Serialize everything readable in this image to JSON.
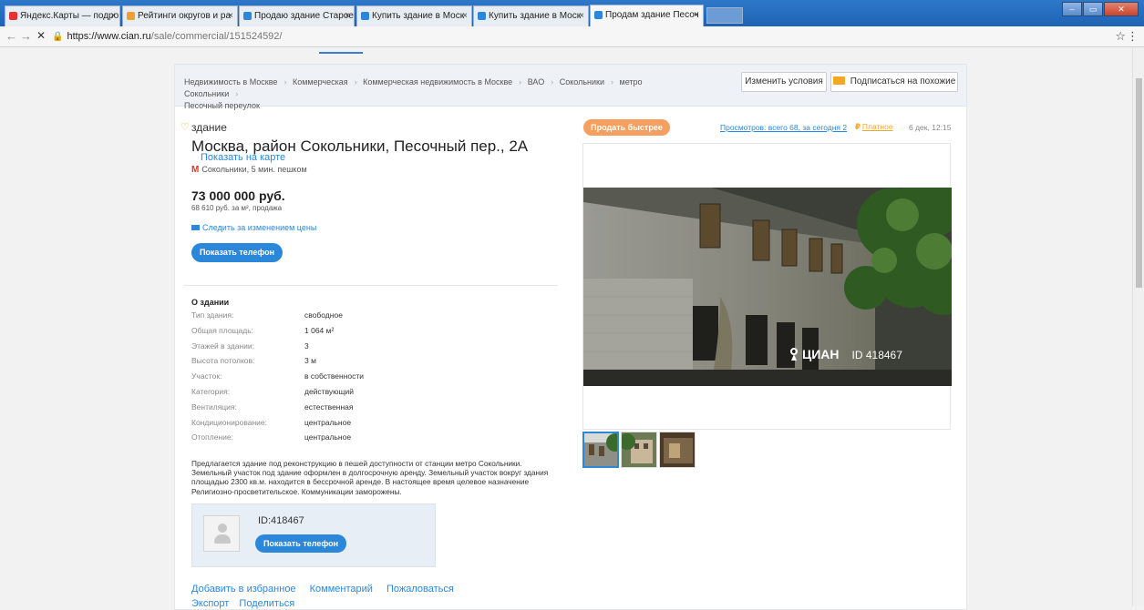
{
  "browser": {
    "tabs": [
      {
        "label": "Яндекс.Карты — подро",
        "icon": "yandex-maps-icon",
        "color": "#e3342f"
      },
      {
        "label": "Рейтинги округов и ра",
        "icon": "page-icon",
        "color": "#f0a030"
      },
      {
        "label": "Продаю здание Старое",
        "icon": "page-icon",
        "color": "#2b87da"
      },
      {
        "label": "Купить здание в Моск",
        "icon": "page-icon",
        "color": "#2b87da"
      },
      {
        "label": "Купить здание в Моск",
        "icon": "page-icon",
        "color": "#2b87da"
      },
      {
        "label": "Продам здание Песоч",
        "icon": "loading-icon",
        "color": "#2b87da"
      }
    ],
    "url_host": "https://www.cian.ru",
    "url_path": "/sale/commercial/151524592/",
    "back": "←",
    "forward": "→",
    "stop": "✕",
    "star": "☆",
    "menu": "⋮",
    "win_min": "–",
    "win_max": "▭",
    "win_close": "✕"
  },
  "breadcrumbs": [
    "Недвижимость в Москве",
    "Коммерческая",
    "Коммерческая недвижимость в Москве",
    "ВАО",
    "Сокольники",
    "метро Сокольники",
    "Песочный переулок"
  ],
  "header_buttons": {
    "change": "Изменить условия",
    "subscribe": "Подписаться на похожие"
  },
  "listing": {
    "favorite_icon": "♡",
    "kind": "здание",
    "address": "Москва, район Сокольники, Песочный пер., 2А",
    "map_link": "Показать на карте",
    "metro_icon": "M",
    "metro": "Сокольники,",
    "metro_walk": "5 мин. пешком",
    "price": "73 000 000 руб.",
    "price_sub": "68 610 руб. за м², продажа",
    "follow_price": "Следить за изменением цены",
    "show_phone": "Показать телефон"
  },
  "about": {
    "title": "О здании",
    "specs": [
      {
        "k": "Тип здания:",
        "v": "свободное"
      },
      {
        "k": "Общая площадь:",
        "v": "1 064 м²"
      },
      {
        "k": "Этажей в здании:",
        "v": "3"
      },
      {
        "k": "Высота потолков:",
        "v": "3 м"
      },
      {
        "k": "Участок:",
        "v": "в собственности"
      },
      {
        "k": "Категория:",
        "v": "действующий"
      },
      {
        "k": "Вентиляция:",
        "v": "естественная"
      },
      {
        "k": "Кондиционирование:",
        "v": "центральное"
      },
      {
        "k": "Отопление:",
        "v": "центральное"
      }
    ],
    "description": "Предлагается здание под реконструкцию в пешей доступности от станции метро Сокольники. Земельный участок под здание оформлен в долгосрочную аренду. Земельный участок вокруг здания площадью 2300 кв.м. находится в бессрочной аренде. В настоящее время целевое назначение Религиозно-просветительское. Коммуникации заморожены."
  },
  "agent": {
    "id": "ID:418467",
    "show_phone": "Показать телефон"
  },
  "actions": {
    "favorite": "Добавить в избранное",
    "comment": "Комментарий",
    "complain": "Пожаловаться",
    "export": "Экспорт",
    "share": "Поделиться"
  },
  "side": {
    "sell_faster": "Продать быстрее",
    "views": "Просмотров: всего 68, за сегодня 2",
    "paid_icon": "₽",
    "paid": "Платное",
    "date": "6 дек, 12:15"
  },
  "photo": {
    "watermark": "ЦИАН",
    "watermark_id": "ID 418467"
  }
}
